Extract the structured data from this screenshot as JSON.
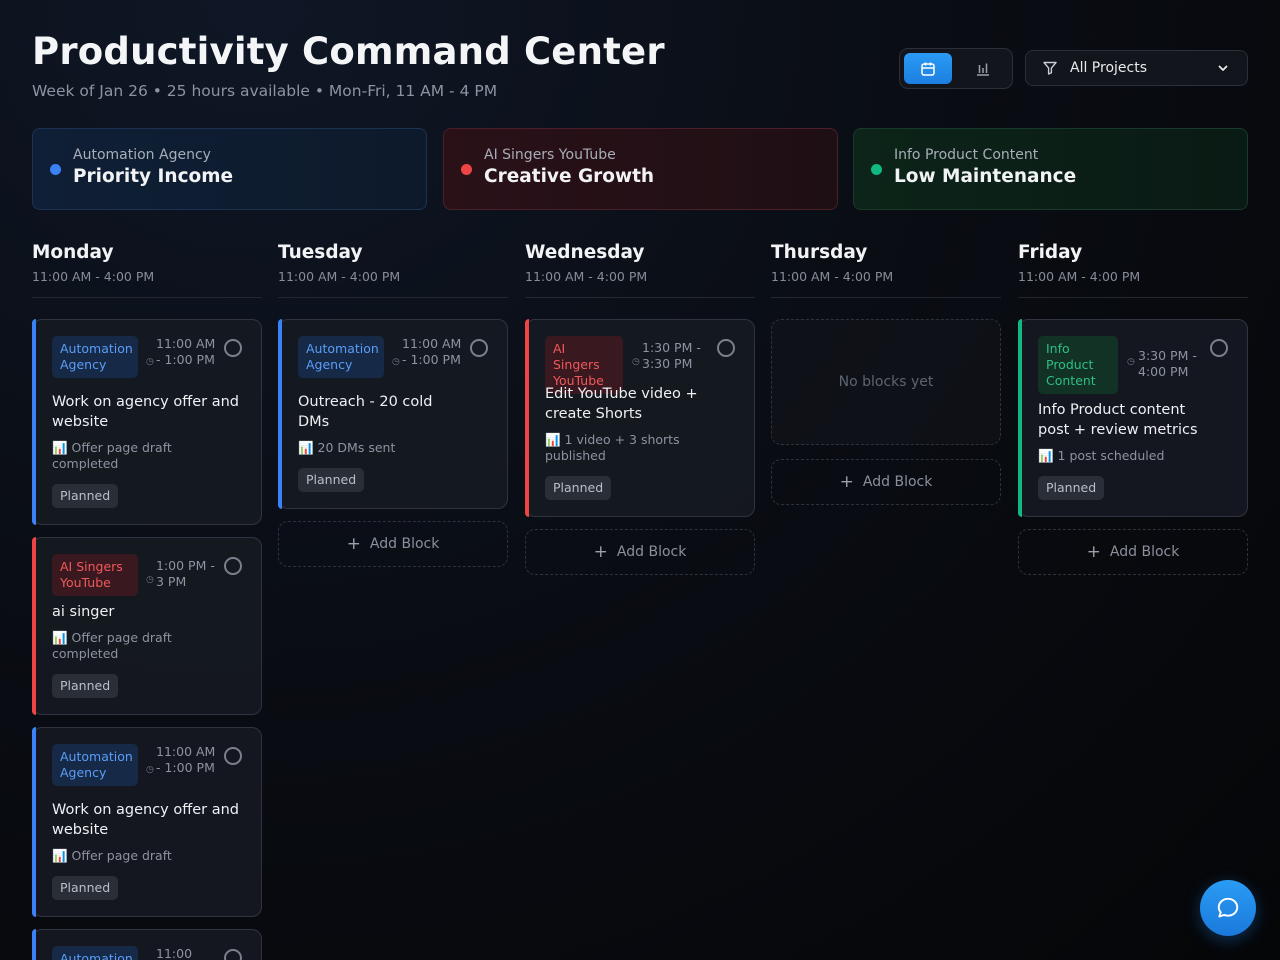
{
  "header": {
    "title": "Productivity Command Center",
    "subtitle": "Week of Jan 26 • 25 hours available • Mon-Fri, 11 AM - 4 PM"
  },
  "toolbar": {
    "calendar_view_icon": "calendar-icon",
    "stats_view_icon": "bar-chart-icon",
    "active_view": "calendar",
    "filter_label": "All Projects",
    "filter_icon": "filter-icon"
  },
  "projects": [
    {
      "name": "Automation Agency",
      "subtitle": "Priority Income",
      "color": "#3b82f6"
    },
    {
      "name": "AI Singers YouTube",
      "subtitle": "Creative Growth",
      "color": "#ef4444"
    },
    {
      "name": "Info Product Content",
      "subtitle": "Low Maintenance",
      "color": "#10b981"
    }
  ],
  "days": [
    {
      "name": "Monday",
      "hours": "11:00 AM - 4:00 PM",
      "blocks": [
        {
          "project": "Automation Agency",
          "time": "11:00 AM - 1:00 PM",
          "title": "Work on agency offer and website",
          "metric": "📊 Offer page draft completed",
          "status": "Planned"
        },
        {
          "project": "AI Singers YouTube",
          "time": "1:00 PM - 3 PM",
          "title": "ai singer",
          "metric": "📊 Offer page draft completed",
          "status": "Planned"
        },
        {
          "project": "Automation Agency",
          "time": "11:00 AM - 1:00 PM",
          "title": "Work on agency offer and website",
          "metric": "📊 Offer page draft",
          "status": "Planned"
        },
        {
          "project": "Automation Agency",
          "time": "11:00"
        }
      ]
    },
    {
      "name": "Tuesday",
      "hours": "11:00 AM - 4:00 PM",
      "blocks": [
        {
          "project": "Automation Agency",
          "time": "11:00 AM - 1:00 PM",
          "title": "Outreach - 20 cold DMs",
          "metric": "📊 20 DMs sent",
          "status": "Planned"
        }
      ],
      "add_label": "Add Block"
    },
    {
      "name": "Wednesday",
      "hours": "11:00 AM - 4:00 PM",
      "blocks": [
        {
          "project": "AI Singers YouTube",
          "time": "1:30 PM - 3:30 PM",
          "title": "Edit YouTube video + create Shorts",
          "metric": "📊 1 video + 3 shorts published",
          "status": "Planned"
        }
      ],
      "add_label": "Add Block"
    },
    {
      "name": "Thursday",
      "hours": "11:00 AM - 4:00 PM",
      "empty_label": "No blocks yet",
      "add_label": "Add Block"
    },
    {
      "name": "Friday",
      "hours": "11:00 AM - 4:00 PM",
      "blocks": [
        {
          "project": "Info Product Content",
          "time": "3:30 PM - 4:00 PM",
          "title": "Info Product content post + review metrics",
          "metric": "📊 1 post scheduled",
          "status": "Planned"
        }
      ],
      "add_label": "Add Block"
    }
  ],
  "chat_button_icon": "chat-bubble-icon"
}
